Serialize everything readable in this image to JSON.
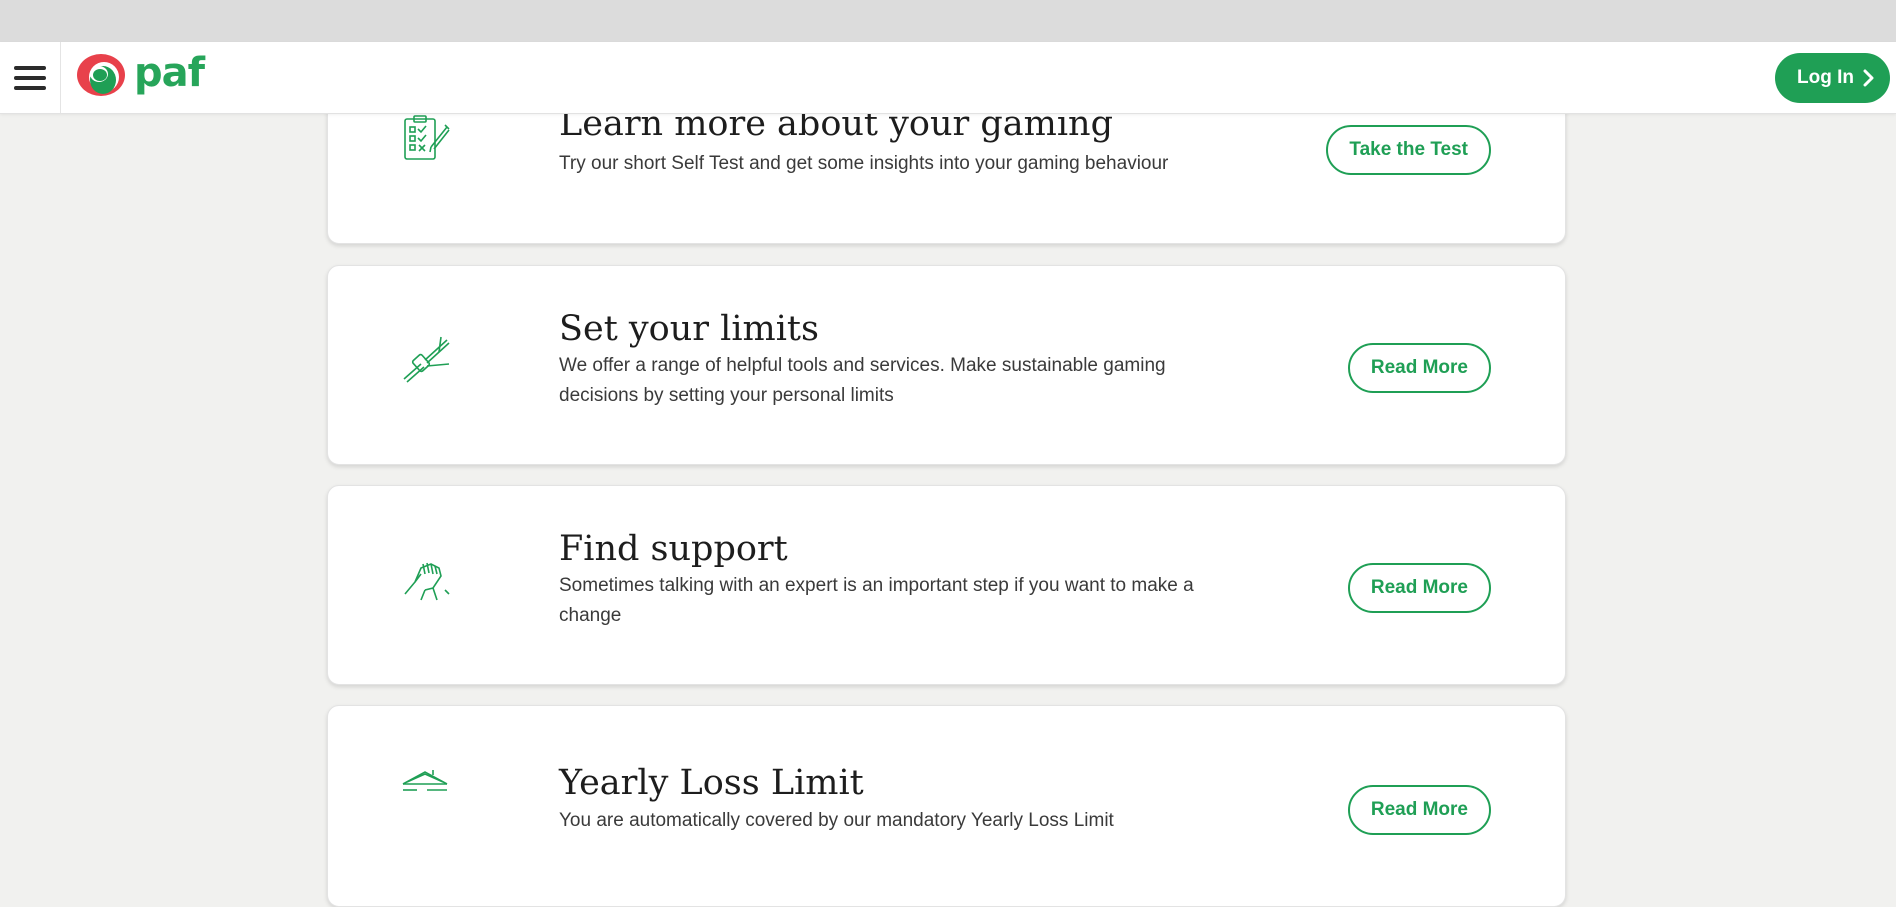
{
  "header": {
    "menu_icon": "hamburger-menu-icon",
    "logo_text": "paf",
    "login_label": "Log In",
    "login_icon": "chevron-right-icon",
    "brand_green": "#1f9f55",
    "brand_red": "#e8414b"
  },
  "cards": [
    {
      "icon": "self-test-checklist-icon",
      "title": "Learn more about your gaming",
      "description": "Try our short Self Test and get some insights into your gaming behaviour",
      "button_label": "Take the Test"
    },
    {
      "icon": "seatbelt-icon",
      "title": "Set your limits",
      "description": "We offer a range of helpful tools and services. Make sustainable gaming decisions by setting your personal limits",
      "button_label": "Read More"
    },
    {
      "icon": "handshake-icon",
      "title": "Find support",
      "description": "Sometimes talking with an expert is an important step if you want to make a change",
      "button_label": "Read More"
    },
    {
      "icon": "house-roof-icon",
      "title": "Yearly Loss Limit",
      "description": "You are automatically covered by our mandatory Yearly Loss Limit",
      "button_label": "Read More"
    }
  ]
}
